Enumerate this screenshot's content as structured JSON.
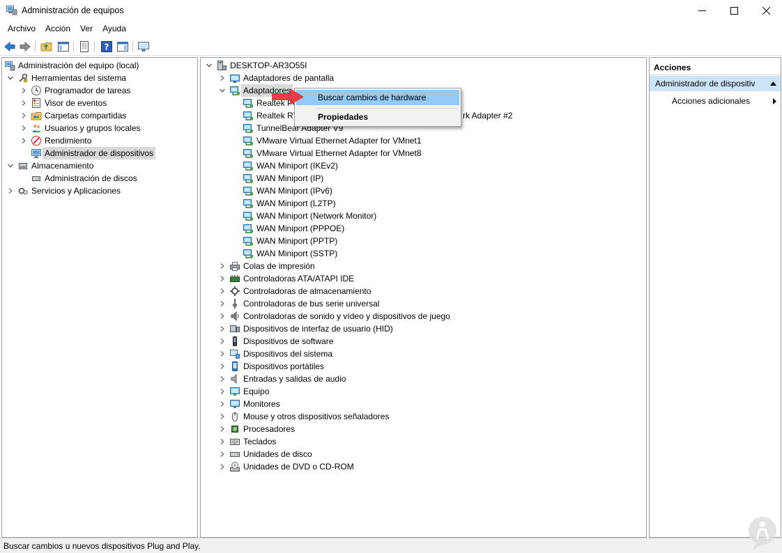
{
  "window": {
    "title": "Administración de equipos"
  },
  "menubar": [
    "Archivo",
    "Acción",
    "Ver",
    "Ayuda"
  ],
  "toolbar": [
    "back-icon",
    "forward-icon",
    "up-folder-icon",
    "show-hide-tree-icon",
    "properties-icon",
    "help-icon",
    "show-action-pane-icon",
    "monitor-icon"
  ],
  "left_tree": [
    {
      "label": "Administración del equipo (local)",
      "depth": 0,
      "chevron": "none",
      "icon": "computer-management-icon"
    },
    {
      "label": "Herramientas del sistema",
      "depth": 1,
      "chevron": "down",
      "icon": "tools-icon"
    },
    {
      "label": "Programador de tareas",
      "depth": 2,
      "chevron": "right",
      "icon": "clock-icon"
    },
    {
      "label": "Visor de eventos",
      "depth": 2,
      "chevron": "right",
      "icon": "event-viewer-icon"
    },
    {
      "label": "Carpetas compartidas",
      "depth": 2,
      "chevron": "right",
      "icon": "shared-folder-icon"
    },
    {
      "label": "Usuarios y grupos locales",
      "depth": 2,
      "chevron": "right",
      "icon": "users-icon"
    },
    {
      "label": "Rendimiento",
      "depth": 2,
      "chevron": "right",
      "icon": "performance-icon"
    },
    {
      "label": "Administrador de dispositivos",
      "depth": 2,
      "chevron": "none",
      "icon": "device-manager-icon",
      "selected": true
    },
    {
      "label": "Almacenamiento",
      "depth": 1,
      "chevron": "down",
      "icon": "storage-icon"
    },
    {
      "label": "Administración de discos",
      "depth": 2,
      "chevron": "none",
      "icon": "disk-icon"
    },
    {
      "label": "Servicios y Aplicaciones",
      "depth": 1,
      "chevron": "right",
      "icon": "services-icon"
    }
  ],
  "device_tree": [
    {
      "label": "DESKTOP-AR3O55I",
      "depth": 0,
      "chevron": "down",
      "icon": "computer-icon"
    },
    {
      "label": "Adaptadores de pantalla",
      "depth": 1,
      "chevron": "right",
      "icon": "display-adapter-icon"
    },
    {
      "label": "Adaptadores",
      "depth": 1,
      "chevron": "down",
      "icon": "network-adapter-icon",
      "selected": true
    },
    {
      "label": "Realtek PC",
      "depth": 2,
      "chevron": "none",
      "icon": "network-adapter-icon"
    },
    {
      "label": "Realtek RT",
      "depth": 2,
      "chevron": "none",
      "icon": "network-adapter-icon",
      "tail": "rk Adapter #2"
    },
    {
      "label": "TunnelBear Adapter V9",
      "depth": 2,
      "chevron": "none",
      "icon": "network-adapter-icon"
    },
    {
      "label": "VMware Virtual Ethernet Adapter for VMnet1",
      "depth": 2,
      "chevron": "none",
      "icon": "network-adapter-icon"
    },
    {
      "label": "VMware Virtual Ethernet Adapter for VMnet8",
      "depth": 2,
      "chevron": "none",
      "icon": "network-adapter-icon"
    },
    {
      "label": "WAN Miniport (IKEv2)",
      "depth": 2,
      "chevron": "none",
      "icon": "network-adapter-icon"
    },
    {
      "label": "WAN Miniport (IP)",
      "depth": 2,
      "chevron": "none",
      "icon": "network-adapter-icon"
    },
    {
      "label": "WAN Miniport (IPv6)",
      "depth": 2,
      "chevron": "none",
      "icon": "network-adapter-icon"
    },
    {
      "label": "WAN Miniport (L2TP)",
      "depth": 2,
      "chevron": "none",
      "icon": "network-adapter-icon"
    },
    {
      "label": "WAN Miniport (Network Monitor)",
      "depth": 2,
      "chevron": "none",
      "icon": "network-adapter-icon"
    },
    {
      "label": "WAN Miniport (PPPOE)",
      "depth": 2,
      "chevron": "none",
      "icon": "network-adapter-icon"
    },
    {
      "label": "WAN Miniport (PPTP)",
      "depth": 2,
      "chevron": "none",
      "icon": "network-adapter-icon"
    },
    {
      "label": "WAN Miniport (SSTP)",
      "depth": 2,
      "chevron": "none",
      "icon": "network-adapter-icon"
    },
    {
      "label": "Colas de impresión",
      "depth": 1,
      "chevron": "right",
      "icon": "printer-icon"
    },
    {
      "label": "Controladoras ATA/ATAPI IDE",
      "depth": 1,
      "chevron": "right",
      "icon": "ide-controller-icon"
    },
    {
      "label": "Controladoras de almacenamiento",
      "depth": 1,
      "chevron": "right",
      "icon": "storage-controller-icon"
    },
    {
      "label": "Controladoras de bus serie universal",
      "depth": 1,
      "chevron": "right",
      "icon": "usb-icon"
    },
    {
      "label": "Controladoras de sonido y vídeo y dispositivos de juego",
      "depth": 1,
      "chevron": "right",
      "icon": "speaker-icon"
    },
    {
      "label": "Dispositivos de interfaz de usuario (HID)",
      "depth": 1,
      "chevron": "right",
      "icon": "hid-icon"
    },
    {
      "label": "Dispositivos de software",
      "depth": 1,
      "chevron": "right",
      "icon": "software-device-icon"
    },
    {
      "label": "Dispositivos del sistema",
      "depth": 1,
      "chevron": "right",
      "icon": "system-device-icon"
    },
    {
      "label": "Dispositivos portátiles",
      "depth": 1,
      "chevron": "right",
      "icon": "portable-device-icon"
    },
    {
      "label": "Entradas y salidas de audio",
      "depth": 1,
      "chevron": "right",
      "icon": "audio-io-icon"
    },
    {
      "label": "Equipo",
      "depth": 1,
      "chevron": "right",
      "icon": "monitor-icon"
    },
    {
      "label": "Monitores",
      "depth": 1,
      "chevron": "right",
      "icon": "monitor-icon"
    },
    {
      "label": "Mouse y otros dispositivos señaladores",
      "depth": 1,
      "chevron": "right",
      "icon": "mouse-icon"
    },
    {
      "label": "Procesadores",
      "depth": 1,
      "chevron": "right",
      "icon": "processor-icon"
    },
    {
      "label": "Teclados",
      "depth": 1,
      "chevron": "right",
      "icon": "keyboard-icon"
    },
    {
      "label": "Unidades de disco",
      "depth": 1,
      "chevron": "right",
      "icon": "disk-drive-icon"
    },
    {
      "label": "Unidades de DVD o CD-ROM",
      "depth": 1,
      "chevron": "right",
      "icon": "dvd-icon"
    }
  ],
  "context_menu": {
    "scan_label": "Buscar cambios de hardware",
    "properties_label": "Propiedades"
  },
  "actions": {
    "header": "Acciones",
    "selected": "Administrador de dispositiv",
    "more": "Acciones adicionales"
  },
  "statusbar": {
    "text": "Buscar cambios u nuevos dispositivos Plug and Play."
  },
  "colors": {
    "selection": "#91c9f7",
    "action_selected": "#cce4f7",
    "annotation_arrow": "#e8303a"
  }
}
